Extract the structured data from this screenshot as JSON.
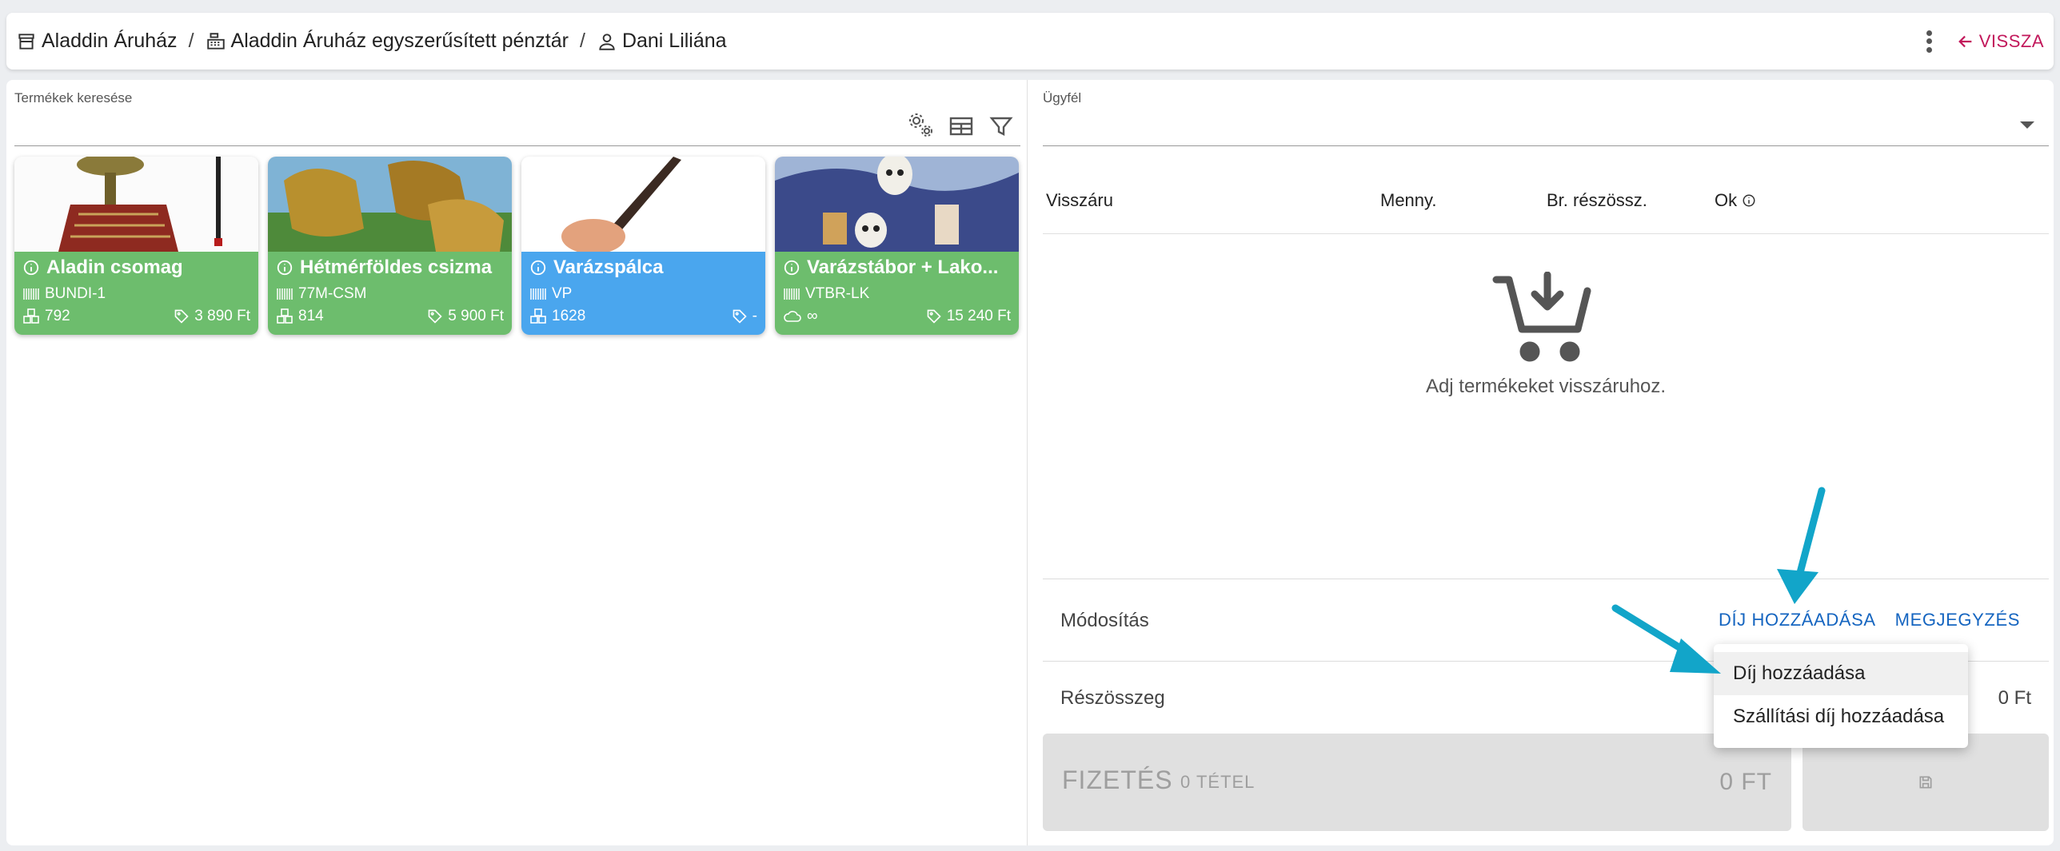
{
  "header": {
    "crumbs": [
      "Aladdin Áruház",
      "Aladdin Áruház egyszerűsített pénztár",
      "Dani Liliána"
    ],
    "separator": "/",
    "back_label": "VISSZA"
  },
  "search": {
    "label": "Termékek keresése"
  },
  "products": [
    {
      "title": "Aladin csomag",
      "code": "BUNDI-1",
      "stock": "792",
      "price": "3 890 Ft",
      "color": "#6dbd6d"
    },
    {
      "title": "Hétmérföldes csizma",
      "code": "77M-CSM",
      "stock": "814",
      "price": "5 900 Ft",
      "color": "#6dbd6d"
    },
    {
      "title": "Varázspálca",
      "code": "VP",
      "stock": "1628",
      "price": "-",
      "color": "#4aa6ee"
    },
    {
      "title": "Varázstábor + Lako...",
      "code": "VTBR-LK",
      "stock": "∞",
      "price": "15 240 Ft",
      "color": "#6dbd6d"
    }
  ],
  "customer": {
    "label": "Ügyfél"
  },
  "table": {
    "headers": [
      "Visszáru",
      "Menny.",
      "Br. részössz.",
      "Ok"
    ]
  },
  "empty": {
    "text": "Adj termékeket visszáruhoz."
  },
  "modification": {
    "label": "Módosítás",
    "add_fee": "DÍJ HOZZÁADÁSA",
    "note": "MEGJEGYZÉS"
  },
  "subtotal": {
    "label": "Részösszeg",
    "value": "0 Ft"
  },
  "payment": {
    "label": "FIZETÉS",
    "count": "0 TÉTEL",
    "total": "0 FT"
  },
  "dropdown": {
    "items": [
      "Díj hozzáadása",
      "Szállítási díj hozzáadása"
    ]
  }
}
